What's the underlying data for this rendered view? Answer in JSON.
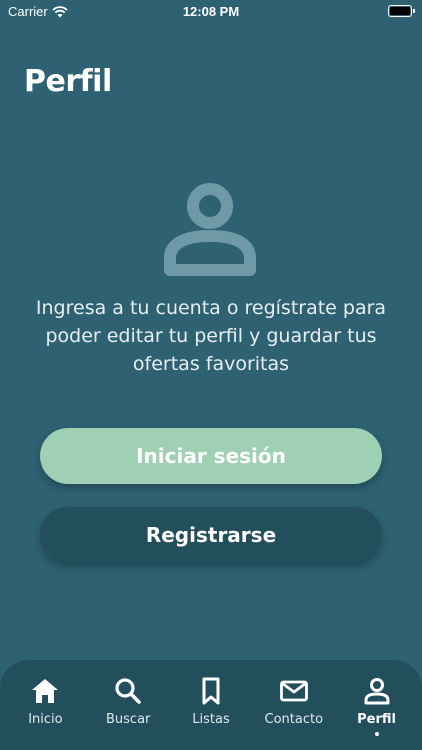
{
  "status_bar": {
    "carrier": "Carrier",
    "time": "12:08 PM"
  },
  "page": {
    "title": "Perfil",
    "message": "Ingresa a tu cuenta o regístrate para poder editar tu perfil y guardar tus ofertas favoritas"
  },
  "actions": {
    "login_label": "Iniciar sesión",
    "register_label": "Registrarse"
  },
  "tab_bar": {
    "items": [
      {
        "label": "Inicio",
        "icon": "home-icon"
      },
      {
        "label": "Buscar",
        "icon": "search-icon"
      },
      {
        "label": "Listas",
        "icon": "bookmark-icon"
      },
      {
        "label": "Contacto",
        "icon": "mail-icon"
      },
      {
        "label": "Perfil",
        "icon": "person-icon",
        "active": true
      }
    ]
  },
  "colors": {
    "background": "#2e6172",
    "primary_button": "#9fd0b3",
    "secondary_button": "#234e5c",
    "tab_bar": "#234e5c"
  }
}
